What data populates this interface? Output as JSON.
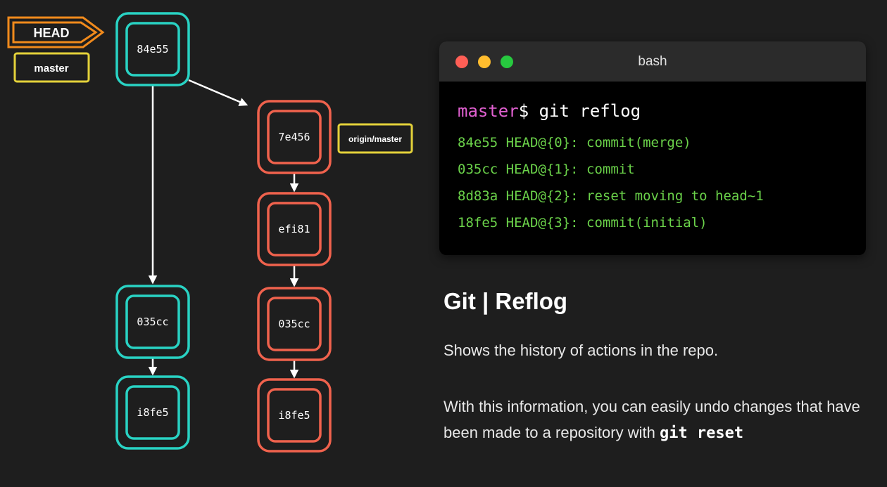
{
  "graph": {
    "head_label": "HEAD",
    "master_label": "master",
    "origin_label": "origin/master",
    "local_commits": [
      "84e55",
      "035cc",
      "i8fe5"
    ],
    "remote_commits": [
      "7e456",
      "efi81",
      "035cc",
      "i8fe5"
    ],
    "colors": {
      "local": "#29d3c4",
      "remote": "#f0624d",
      "head": "#f08a1c",
      "tag": "#e4d23a"
    }
  },
  "terminal": {
    "title": "bash",
    "prompt_branch": "master",
    "prompt_symbol": "$ ",
    "command": "git reflog",
    "output": [
      "84e55 HEAD@{0}: commit(merge)",
      "035cc HEAD@{1}: commit",
      "8d83a HEAD@{2}: reset moving to head~1",
      "18fe5 HEAD@{3}: commit(initial)"
    ]
  },
  "info": {
    "title": "Git | Reflog",
    "paragraph1": "Shows the history of actions in the repo.",
    "paragraph2_text": "With this information, you can easily undo changes that have been made to a repository with ",
    "paragraph2_code": "git reset"
  }
}
